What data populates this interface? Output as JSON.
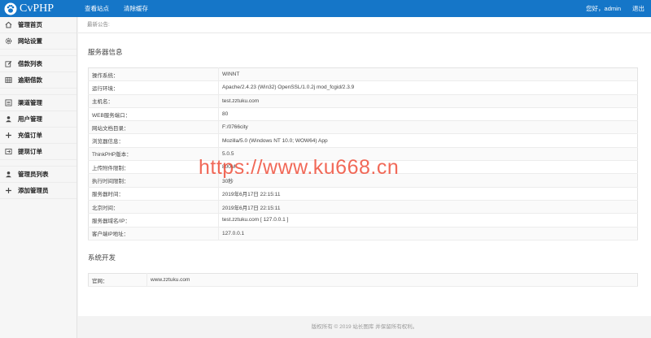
{
  "app": {
    "logo_text": "CvPHP"
  },
  "topnav": [
    {
      "label": "查看站点"
    },
    {
      "label": "清除缓存"
    }
  ],
  "topright": {
    "greeting": "您好，admin",
    "logout": "退出"
  },
  "sidebar": {
    "items": [
      {
        "label": "管理首页",
        "icon": "home-icon"
      },
      {
        "label": "网站设置",
        "icon": "gear-icon"
      },
      {
        "label": "借款列表",
        "icon": "edit-icon"
      },
      {
        "label": "逾期借款",
        "icon": "table-icon"
      },
      {
        "label": "渠道管理",
        "icon": "list-icon"
      },
      {
        "label": "用户管理",
        "icon": "user-icon"
      },
      {
        "label": "充值订单",
        "icon": "plus-icon"
      },
      {
        "label": "提现订单",
        "icon": "export-icon"
      },
      {
        "label": "管理员列表",
        "icon": "user-icon"
      },
      {
        "label": "添加管理员",
        "icon": "plus-icon"
      }
    ]
  },
  "notice": {
    "label": "最新公告:"
  },
  "server": {
    "title": "服务器信息",
    "rows": [
      {
        "label": "操作系统：",
        "value": "WINNT"
      },
      {
        "label": "运行环境：",
        "value": "Apache/2.4.23 (Win32) OpenSSL/1.0.2j mod_fcgid/2.3.9"
      },
      {
        "label": "主机名：",
        "value": "test.zztuku.com"
      },
      {
        "label": "WEB服务端口：",
        "value": "80"
      },
      {
        "label": "网站文档目录：",
        "value": "F:/0766city"
      },
      {
        "label": "浏览器信息：",
        "value": "Mozilla/5.0 (Windows NT 10.0; WOW64) App"
      },
      {
        "label": "ThinkPHP版本：",
        "value": "5.0.5"
      },
      {
        "label": "上传附件限制：",
        "value": "800M"
      },
      {
        "label": "执行时间限制：",
        "value": "30秒"
      },
      {
        "label": "服务器时间：",
        "value": "2019年6月17日 22:15:11"
      },
      {
        "label": "北京时间：",
        "value": "2019年6月17日 22:15:11"
      },
      {
        "label": "服务器域名/IP：",
        "value": "test.zztuku.com [ 127.0.0.1 ]"
      },
      {
        "label": "客户端IP地址：",
        "value": "127.0.0.1"
      }
    ]
  },
  "dev": {
    "title": "系统开发",
    "rows": [
      {
        "label": "官网：",
        "value": "www.zztuku.com"
      }
    ]
  },
  "footer": {
    "text": "版权所有 © 2019 站长图库 并保留所有权利。"
  },
  "watermark": {
    "text": "https://www.ku668.cn"
  },
  "colors": {
    "header": "#1576c8",
    "watermark": "#ef4f3b"
  }
}
